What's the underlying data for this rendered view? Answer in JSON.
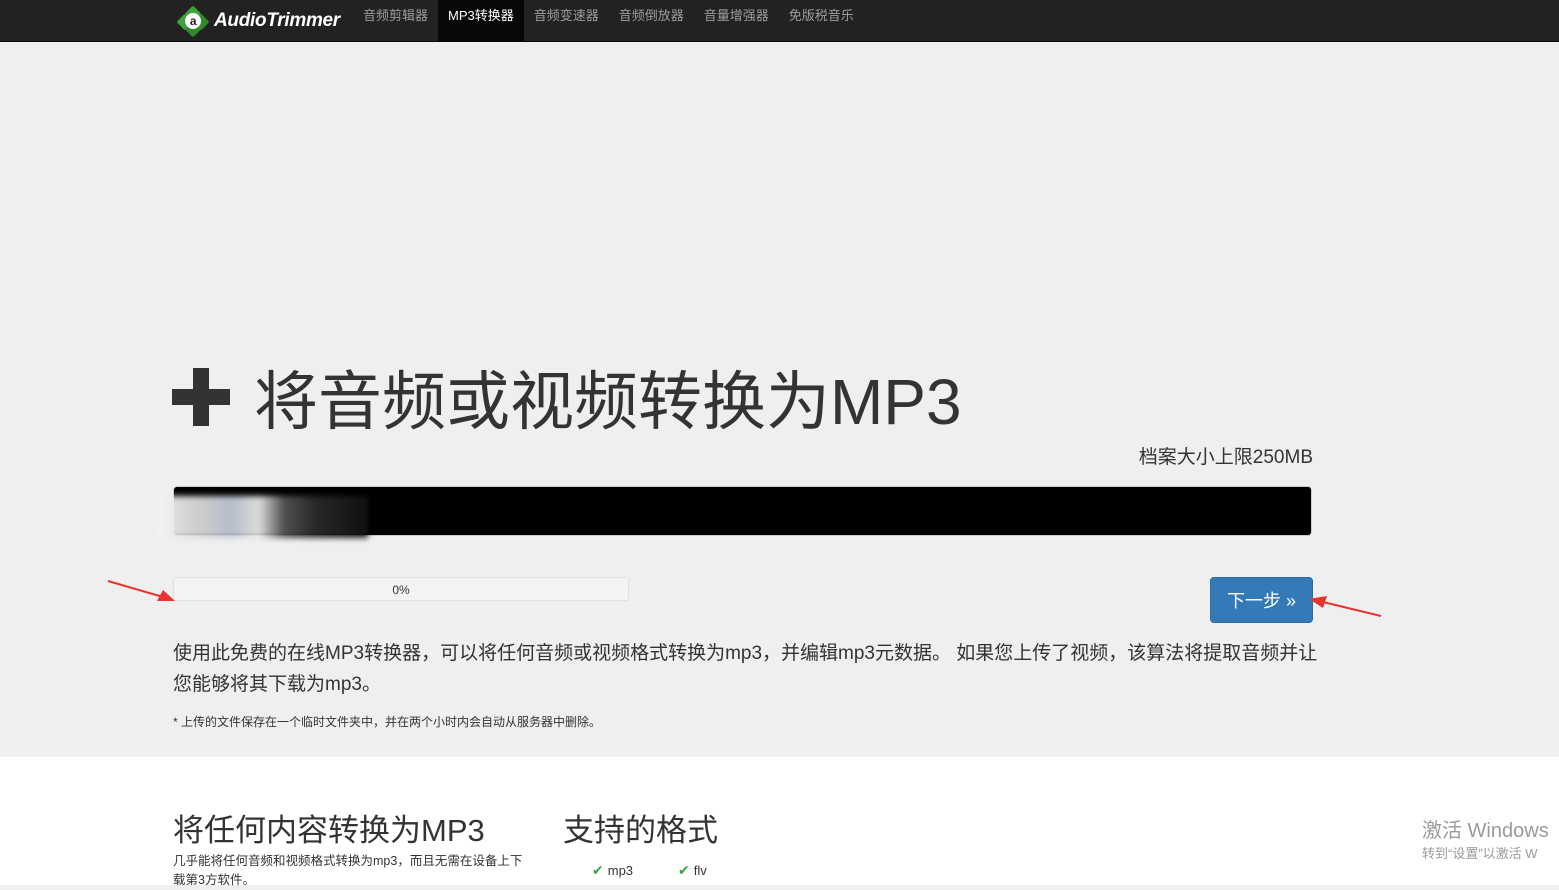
{
  "brand": {
    "name": "AudioTrimmer",
    "logo_letter": "a"
  },
  "nav": {
    "items": [
      {
        "label": "音频剪辑器",
        "active": false
      },
      {
        "label": "MP3转换器",
        "active": true
      },
      {
        "label": "音频变速器",
        "active": false
      },
      {
        "label": "音频倒放器",
        "active": false
      },
      {
        "label": "音量增强器",
        "active": false
      },
      {
        "label": "免版税音乐",
        "active": false
      }
    ]
  },
  "hero": {
    "title": "将音频或视频转换为MP3",
    "size_limit": "档案大小上限250MB"
  },
  "upload": {
    "progress_label": "0%",
    "progress_percent": 0,
    "next_button": "下一步 »"
  },
  "description": "使用此免费的在线MP3转换器，可以将任何音频或视频格式转换为mp3，并编辑mp3元数据。 如果您上传了视频，该算法将提取音频并让您能够将其下载为mp3。",
  "note": "* 上传的文件保存在一个临时文件夹中，并在两个小时内会自动从服务器中删除。",
  "section1": {
    "title": "将任何内容转换为MP3",
    "text": "几乎能将任何音频和视频格式转换为mp3，而且无需在设备上下载第3方软件。"
  },
  "section2": {
    "title": "支持的格式",
    "formats": [
      "mp3",
      "flv"
    ]
  },
  "watermark": {
    "line1": "激活 Windows",
    "line2": "转到“设置”以激活 W"
  },
  "colors": {
    "accent": "#337ab7",
    "navbar": "#222222",
    "check": "#3aa53a",
    "annotation": "#e8342f"
  }
}
